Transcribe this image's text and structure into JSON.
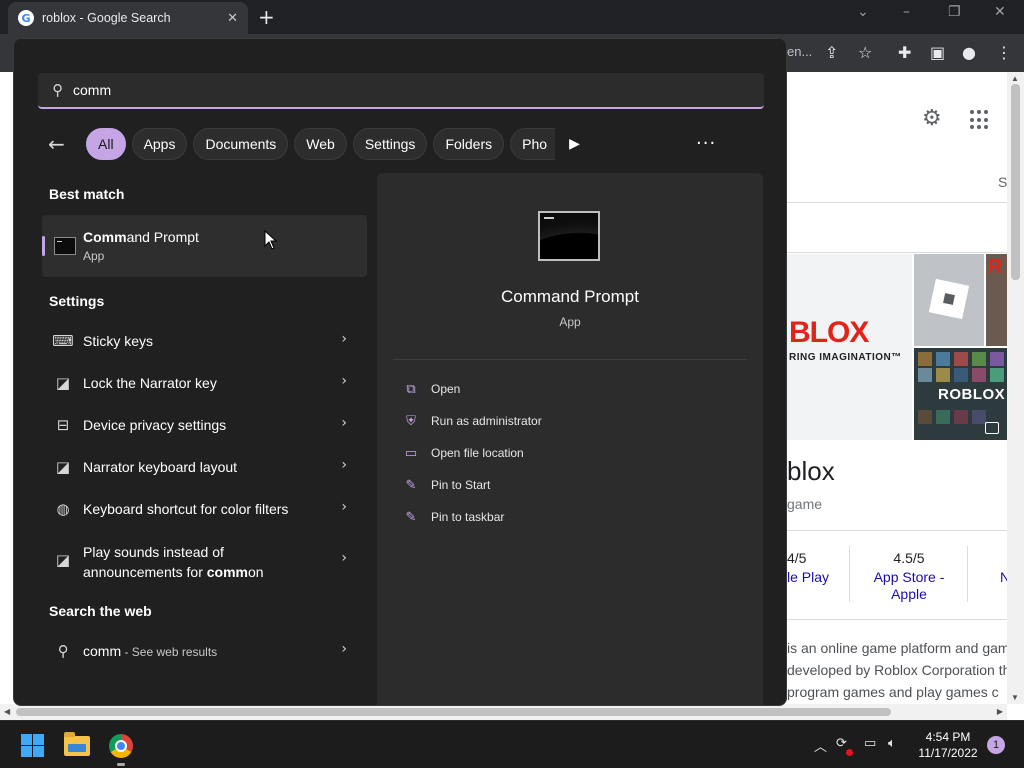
{
  "browser": {
    "tab_title": "roblox - Google Search",
    "tab_favicon": "G",
    "url_fragment": "en...",
    "new_tab_glyph": "+"
  },
  "google": {
    "settings_icon": "gear-icon",
    "right_fragment": "S",
    "logo_text": "BLOX",
    "logo_sub": "RING IMAGINATION™",
    "tile2_letter": "R",
    "tile3_text": "ROBLOX",
    "title_fragment": "blox",
    "subtitle_fragment": "game",
    "ratings": [
      {
        "value": "4/5",
        "source": "le Play"
      },
      {
        "value": "4.5/5",
        "source": "App Store - Apple"
      },
      {
        "value": "",
        "source": "N"
      }
    ],
    "description_lines": [
      "is an online game platform and gam",
      "developed by Roblox Corporation th",
      "program games and play games c"
    ]
  },
  "search": {
    "query": "comm",
    "filters": [
      "All",
      "Apps",
      "Documents",
      "Web",
      "Settings",
      "Folders",
      "Pho"
    ],
    "active_filter": "All",
    "more_label": "···"
  },
  "results": {
    "best_match_label": "Best match",
    "best_match": {
      "highlight": "Comm",
      "rest": "and Prompt",
      "type": "App"
    },
    "settings_label": "Settings",
    "settings_items": [
      {
        "label": "Sticky keys",
        "icon": "keyboard-icon"
      },
      {
        "label": "Lock the Narrator key",
        "icon": "narrator-icon"
      },
      {
        "label": "Device privacy settings",
        "icon": "privacy-icon"
      },
      {
        "label": "Narrator keyboard layout",
        "icon": "narrator-icon"
      },
      {
        "label": "Keyboard shortcut for color filters",
        "icon": "color-filter-icon"
      }
    ],
    "sounds_item": {
      "line1": "Play sounds instead of",
      "line2_pre": "announcements for ",
      "line2_bold": "comm",
      "line2_post": "on"
    },
    "web_label": "Search the web",
    "web_item": {
      "query": "comm",
      "hint": " - See web results"
    }
  },
  "preview": {
    "name": "Command Prompt",
    "type": "App",
    "actions": [
      {
        "label": "Open",
        "icon": "open-external-icon"
      },
      {
        "label": "Run as administrator",
        "icon": "admin-shield-icon"
      },
      {
        "label": "Open file location",
        "icon": "folder-icon"
      },
      {
        "label": "Pin to Start",
        "icon": "pin-icon"
      },
      {
        "label": "Pin to taskbar",
        "icon": "pin-icon"
      }
    ]
  },
  "taskbar": {
    "time": "4:54 PM",
    "date": "11/17/2022",
    "notification_count": "1"
  },
  "colors": {
    "accent": "#c5a5e6",
    "flyout_bg": "#202020",
    "preview_bg": "#2c2c2c",
    "link": "#1a0dab"
  }
}
